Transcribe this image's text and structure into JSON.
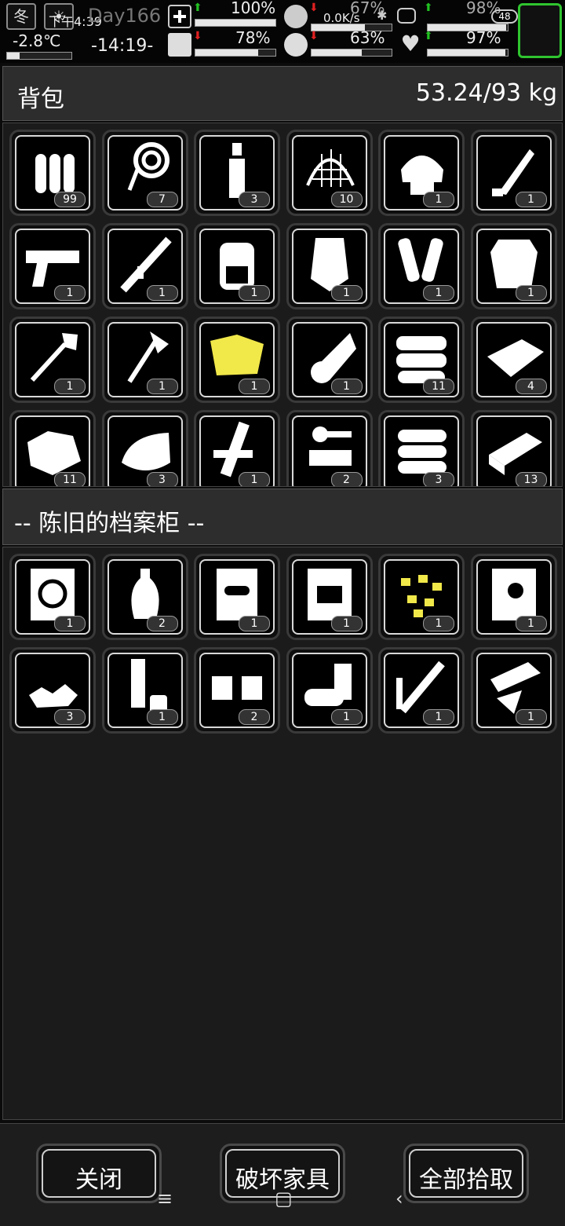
{
  "status": {
    "season": "冬",
    "time": "下午4:39",
    "day": "Day166",
    "temperature": "-2.8℃",
    "game_time": "-14:19-",
    "net_speed": "0.0K/s",
    "battery": "48",
    "stats_top": [
      {
        "icon": "medkit-icon",
        "pct": "100%",
        "trend": "up",
        "level": 1.0
      },
      {
        "icon": "stomach-icon",
        "pct": "67%",
        "trend": "down",
        "level": 0.67
      },
      {
        "icon": "gear-status-icon",
        "pct": "98%",
        "trend": "up",
        "level": 0.98
      }
    ],
    "stats_bottom": [
      {
        "icon": "boot-icon",
        "pct": "78%",
        "trend": "down",
        "level": 0.78
      },
      {
        "icon": "water-drop-icon",
        "pct": "63%",
        "trend": "down",
        "level": 0.63
      },
      {
        "icon": "heart-icon",
        "pct": "97%",
        "trend": "up",
        "level": 0.97
      }
    ]
  },
  "backpack": {
    "title": "背包",
    "weight": "53.24/93 kg",
    "items": [
      {
        "icon": "bullets-icon",
        "count": "99"
      },
      {
        "icon": "rope-icon",
        "count": "7"
      },
      {
        "icon": "bottle-icon",
        "count": "3"
      },
      {
        "icon": "net-icon",
        "count": "10"
      },
      {
        "icon": "helmet-icon",
        "count": "1"
      },
      {
        "icon": "knife-icon",
        "count": "1"
      },
      {
        "icon": "pistol-icon",
        "count": "1"
      },
      {
        "icon": "rifle-icon",
        "count": "1"
      },
      {
        "icon": "backpack-icon",
        "count": "1"
      },
      {
        "icon": "shield-icon",
        "count": "1"
      },
      {
        "icon": "arm-guards-icon",
        "count": "1"
      },
      {
        "icon": "body-armor-icon",
        "count": "1"
      },
      {
        "icon": "shovel-icon",
        "count": "1"
      },
      {
        "icon": "axe-icon",
        "count": "1"
      },
      {
        "icon": "raincoat-icon",
        "count": "1"
      },
      {
        "icon": "paper-roll-icon",
        "count": "1"
      },
      {
        "icon": "cloth-pile-icon",
        "count": "11"
      },
      {
        "icon": "cloth-sheet-icon",
        "count": "4"
      },
      {
        "icon": "rock-icon",
        "count": "11"
      },
      {
        "icon": "fabric-icon",
        "count": "3"
      },
      {
        "icon": "planks-icon",
        "count": "1"
      },
      {
        "icon": "scrap-parts-icon",
        "count": "2"
      },
      {
        "icon": "logs-icon",
        "count": "3"
      },
      {
        "icon": "board-icon",
        "count": "13"
      }
    ]
  },
  "container": {
    "title": "-- 陈旧的档案柜 --",
    "items": [
      {
        "icon": "tire-blueprint-icon",
        "count": "1"
      },
      {
        "icon": "vase-icon",
        "count": "2"
      },
      {
        "icon": "ration-pack-icon",
        "count": "1"
      },
      {
        "icon": "battery-blueprint-icon",
        "count": "1"
      },
      {
        "icon": "gold-nuggets-icon",
        "count": "1"
      },
      {
        "icon": "plug-blueprint-icon",
        "count": "1"
      },
      {
        "icon": "rubble-icon",
        "count": "3"
      },
      {
        "icon": "tube-cup-icon",
        "count": "1"
      },
      {
        "icon": "cash-bundle-icon",
        "count": "2"
      },
      {
        "icon": "cans-icon",
        "count": "1"
      },
      {
        "icon": "glue-tube-icon",
        "count": "1"
      },
      {
        "icon": "glass-shards-icon",
        "count": "1"
      }
    ]
  },
  "buttons": {
    "close": "关闭",
    "destroy": "破坏家具",
    "pickup_all": "全部拾取"
  },
  "navbar": {
    "menu": "≡",
    "home": "▢",
    "back": "‹"
  },
  "colors": {
    "accent_green": "#22c022",
    "warn_red": "#e02020",
    "highlight_yellow": "#f1e84a"
  }
}
